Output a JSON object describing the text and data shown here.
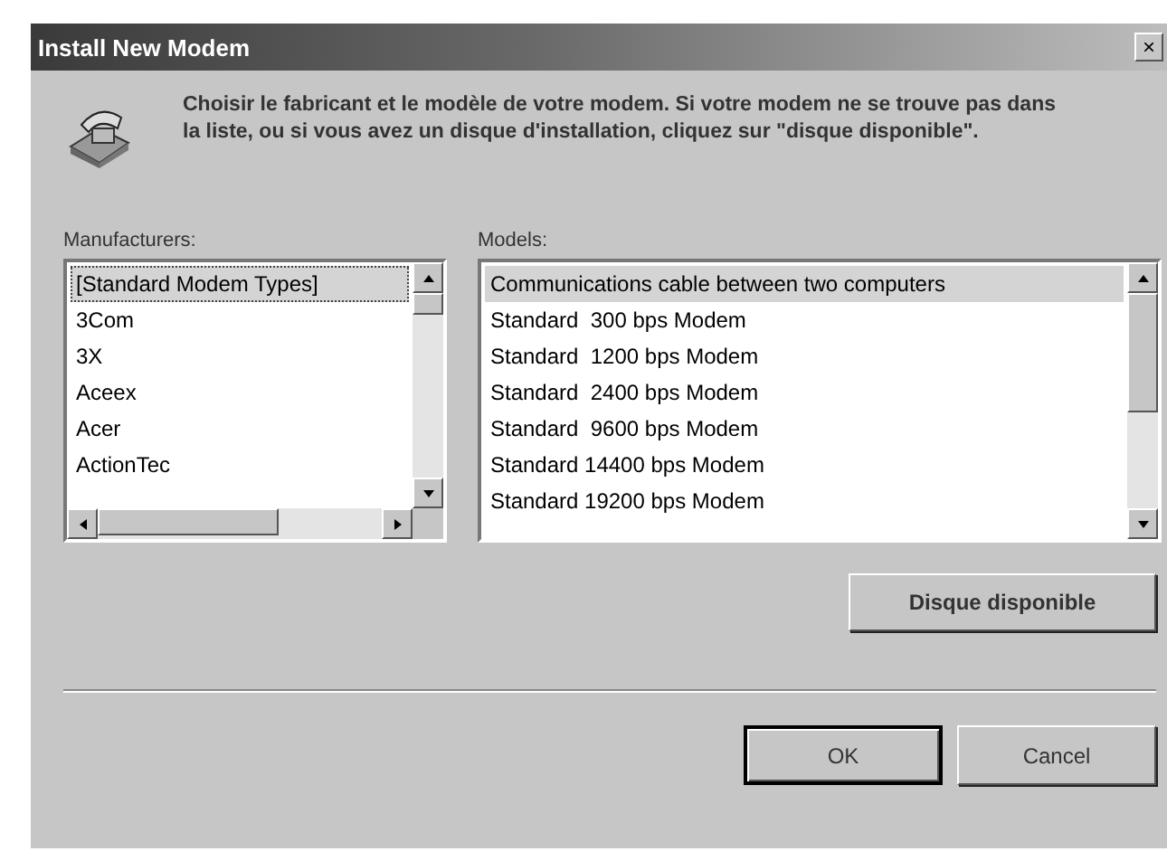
{
  "window": {
    "title": "Install New Modem",
    "close": "×"
  },
  "instructions": "Choisir le fabricant et le modèle de votre modem. Si votre modem ne se trouve pas dans la liste, ou si vous avez un disque d'installation, cliquez sur \"disque disponible\".",
  "manufacturers": {
    "label": "Manufacturers:",
    "items": [
      {
        "label": "[Standard Modem Types]",
        "selected": true
      },
      {
        "label": "3Com",
        "selected": false
      },
      {
        "label": "3X",
        "selected": false
      },
      {
        "label": "Aceex",
        "selected": false
      },
      {
        "label": "Acer",
        "selected": false
      },
      {
        "label": "ActionTec",
        "selected": false
      }
    ]
  },
  "models": {
    "label": "Models:",
    "items": [
      {
        "label": "Communications cable between two computers",
        "selected": true
      },
      {
        "label": "Standard  300 bps Modem",
        "selected": false
      },
      {
        "label": "Standard  1200 bps Modem",
        "selected": false
      },
      {
        "label": "Standard  2400 bps Modem",
        "selected": false
      },
      {
        "label": "Standard  9600 bps Modem",
        "selected": false
      },
      {
        "label": "Standard 14400 bps Modem",
        "selected": false
      },
      {
        "label": "Standard 19200 bps Modem",
        "selected": false
      }
    ]
  },
  "have_disk_button": "Disque disponible",
  "buttons": [
    {
      "label": "OK",
      "default": true
    },
    {
      "label": "Cancel",
      "default": false
    }
  ]
}
